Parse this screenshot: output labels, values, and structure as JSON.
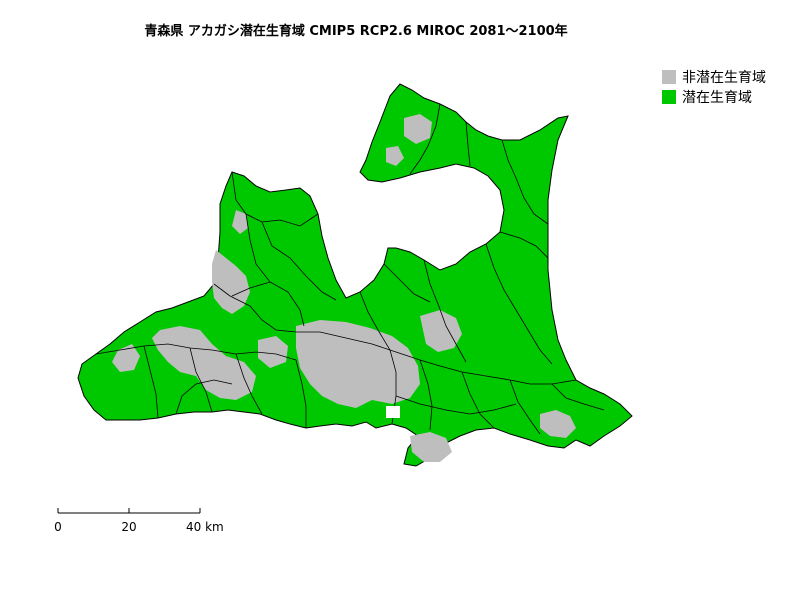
{
  "title": "青森県 アカガシ潜在生育域 CMIP5 RCP2.6 MIROC 2081～2100年",
  "legend": {
    "items": [
      {
        "label": "非潜在生育域",
        "color": "#bebebe"
      },
      {
        "label": "潜在生育域",
        "color": "#00c800"
      }
    ]
  },
  "scalebar": {
    "ticks": [
      "0",
      "20",
      "40 km"
    ]
  },
  "colors": {
    "non_habitat": "#bebebe",
    "habitat": "#00c800",
    "boundary": "#000000"
  }
}
